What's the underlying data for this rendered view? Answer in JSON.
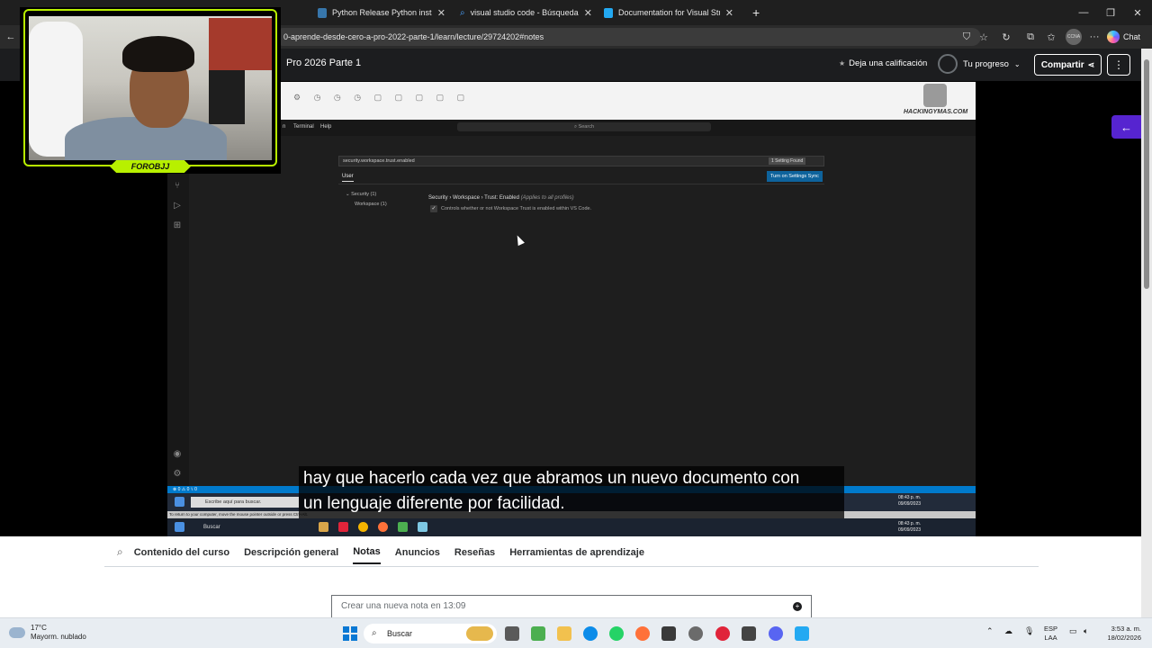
{
  "browser": {
    "tabs": [
      {
        "label": "Python Release Python install man",
        "icon": "python-icon",
        "color": "#3776ab"
      },
      {
        "label": "visual studio code - Búsqueda",
        "icon": "search-icon",
        "color": "#4aa3ff"
      },
      {
        "label": "Documentation for Visual Studio C",
        "icon": "vscode-icon",
        "color": "#23a9f2"
      }
    ],
    "new_tab": "+",
    "window_controls": {
      "minimize": "—",
      "maximize": "❐",
      "close": "✕"
    },
    "url": "0-aprende-desde-cero-a-pro-2022-parte-1/learn/lecture/29724202#notes",
    "chat_label": "Chat",
    "profile_initials": "CCNA"
  },
  "course": {
    "title": "Pro 2026 Parte 1",
    "rate_label": "Deja una calificación",
    "progress_label": "Tu progreso",
    "share_label": "Compartir",
    "more_label": "⋮"
  },
  "webcam": {
    "name": "FOROBJJ"
  },
  "video": {
    "watermark": "HACKINGYMAS.COM",
    "vscode_menu": [
      "n",
      "Terminal",
      "Help"
    ],
    "vscode_search": "Search",
    "settings_query": "security.workspace.trust.enabled",
    "settings_found": "1 Setting Found",
    "sync_button": "Turn on Settings Sync",
    "user_tab": "User",
    "tree_security": "Security (1)",
    "tree_workspace": "Workspace (1)",
    "setting_title": "Security › Workspace › Trust: Enabled",
    "setting_scope": "(Applies to all profiles)",
    "setting_desc": "Controls whether or not Workspace Trust is enabled within VS Code.",
    "status_left": "⊗ 0 ⚠ 0    ⑊ 0",
    "inner_search": "Escribe aquí para buscar.",
    "inner_time": "08:43 p. m.",
    "inner_date": "09/09/2023",
    "vm_note": "To return to your computer, move the mouse pointer outside or press Ctrl+Alt.",
    "host_search": "Buscar",
    "subtitle_line1": "hay que hacerlo cada vez que abramos un nuevo documento con",
    "subtitle_line2": "un lenguaje diferente por facilidad."
  },
  "course_tabs": [
    "Contenido del curso",
    "Descripción general",
    "Notas",
    "Anuncios",
    "Reseñas",
    "Herramientas de aprendizaje"
  ],
  "active_tab": "Notas",
  "note_placeholder": "Crear una nueva nota en 13:09",
  "taskbar": {
    "temperature": "17°C",
    "weather": "Mayorm. nublado",
    "search": "Buscar",
    "lang_top": "ESP",
    "lang_bottom": "LAA",
    "time": "3:53 a. m.",
    "date": "18/02/2026"
  },
  "colors": {
    "accent": "#5624d0",
    "webcam_frame": "#b8f000",
    "vscode_blue": "#007acc"
  }
}
